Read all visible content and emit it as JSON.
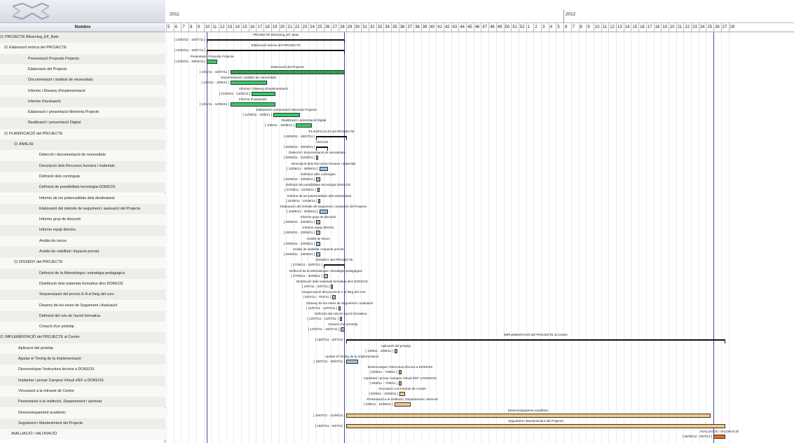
{
  "columns": {
    "name": "Nombre"
  },
  "timeline": {
    "years": [
      "2011",
      "2012"
    ],
    "weeks_2011": [
      "5",
      "6",
      "7",
      "8",
      "9",
      "10",
      "11",
      "12",
      "13",
      "14",
      "15",
      "16",
      "17",
      "18",
      "19",
      "20",
      "21",
      "22",
      "23",
      "24",
      "25",
      "26",
      "27",
      "28",
      "29",
      "30",
      "31",
      "32",
      "33",
      "34",
      "35",
      "36",
      "37",
      "38",
      "39",
      "40",
      "41",
      "42",
      "43",
      "44",
      "45",
      "46",
      "47",
      "48",
      "49",
      "50",
      "51",
      "52"
    ],
    "weeks_2012": [
      "1",
      "2",
      "3",
      "4",
      "5",
      "6",
      "7",
      "8",
      "9",
      "10",
      "11",
      "12",
      "13",
      "14",
      "15",
      "16",
      "17",
      "18",
      "19",
      "20",
      "21",
      "22",
      "23",
      "24",
      "25",
      "26",
      "27",
      "28"
    ]
  },
  "colors": {
    "summary": "#111111",
    "green": "#33cc66",
    "green_hatched": "#2bb35a",
    "blue": "#9fbfe0",
    "orange": "#f0a64a",
    "light_orange": "#f6c987",
    "dark_orange": "#ee6a1a"
  },
  "tasks": [
    {
      "name": "PROJECTE Blearning_EF_Batx",
      "level": 0,
      "toggle": "⊟",
      "dates": "[ 10/03/11 - 16/07/11 ]",
      "type": "summary",
      "start": "2011-03-10",
      "end": "2011-07-16"
    },
    {
      "name": "Elaboració teòrica del PROJECTE",
      "level": 1,
      "toggle": "⊟",
      "dates": "[ 10/03/11 - 16/07/11 ]",
      "type": "summary",
      "start": "2011-03-10",
      "end": "2011-07-16"
    },
    {
      "name": "Presentació Proposta Projecte",
      "level": 2,
      "toggle": "",
      "dates": "[ 10/03/11 - 19/03/11 ]",
      "type": "green",
      "start": "2011-03-10",
      "end": "2011-03-19"
    },
    {
      "name": "Elaboració del Projecte",
      "level": 2,
      "toggle": "",
      "dates": "[ 1/04/11 - 16/07/11 ]",
      "type": "green_hatched",
      "start": "2011-04-01",
      "end": "2011-07-16"
    },
    {
      "name": "Documentació i anàlisis de necessitats",
      "level": 2,
      "toggle": "",
      "dates": "[ 1/04/11 - 4/05/11 ]",
      "type": "green",
      "start": "2011-04-01",
      "end": "2011-05-04"
    },
    {
      "name": "Informe i Disseny d'implementació",
      "level": 2,
      "toggle": "",
      "dates": "[ 21/04/11 - 12/05/11 ]",
      "type": "green",
      "start": "2011-04-21",
      "end": "2011-05-12"
    },
    {
      "name": "Informe d'avaluació",
      "level": 2,
      "toggle": "",
      "dates": "[ 1/04/11 - 12/05/11 ]",
      "type": "green",
      "start": "2011-04-01",
      "end": "2011-05-12"
    },
    {
      "name": "Elaboració i presentació Memòria Projecte",
      "level": 2,
      "toggle": "",
      "dates": "[ 11/05/11 - 4/06/11 ]",
      "type": "green",
      "start": "2011-05-11",
      "end": "2011-06-04"
    },
    {
      "name": "Realització i presentació Digital",
      "level": 2,
      "toggle": "",
      "dates": "[ 1/06/11 - 15/06/11 ]",
      "type": "green",
      "start": "2011-06-01",
      "end": "2011-06-15"
    },
    {
      "name": "PLANIFICACIÓ del PROJECTE",
      "level": 1,
      "toggle": "⊟",
      "dates": "[ 20/06/11 - 18/07/11 ]",
      "type": "summary",
      "start": "2011-06-20",
      "end": "2011-07-18"
    },
    {
      "name": "ANÀLISI",
      "level": 2,
      "toggle": "⊟",
      "dates": "[ 20/06/11 - 30/06/11 ]",
      "type": "summary",
      "start": "2011-06-20",
      "end": "2011-06-30"
    },
    {
      "name": "Detecció i documentació de necessitats",
      "level": 3,
      "toggle": "",
      "dates": "[ 20/06/11 - 21/06/11 ]",
      "type": "blue",
      "start": "2011-06-20",
      "end": "2011-06-21"
    },
    {
      "name": "Descripció dels Recursos humans i materials",
      "level": 3,
      "toggle": "",
      "dates": "[ 23/06/11 - 30/06/11 ]",
      "type": "blue",
      "start": "2011-06-23",
      "end": "2011-06-30"
    },
    {
      "name": "Definició dels continguts",
      "level": 3,
      "toggle": "",
      "dates": "[ 20/06/11 - 23/06/11 ]",
      "type": "blue",
      "start": "2011-06-20",
      "end": "2011-06-23"
    },
    {
      "name": "Definició de possibilitats tecnologia DOKEOS",
      "level": 3,
      "toggle": "",
      "dates": "[ 21/06/11 - 22/06/11 ]",
      "type": "blue",
      "start": "2011-06-21",
      "end": "2011-06-22"
    },
    {
      "name": "Informe de les potencialitats dels destinataris",
      "level": 3,
      "toggle": "",
      "dates": "[ 22/06/11 - 23/06/11 ]",
      "type": "blue",
      "start": "2011-06-22",
      "end": "2011-06-23"
    },
    {
      "name": "Elaboració del mètode de seguiment i avaluació del Projecte",
      "level": 3,
      "toggle": "",
      "dates": "[ 23/06/11 - 30/06/11 ]",
      "type": "blue",
      "start": "2011-06-23",
      "end": "2011-06-30"
    },
    {
      "name": "Informe grup de discusió",
      "level": 3,
      "toggle": "",
      "dates": "[ 20/06/11 - 23/06/11 ]",
      "type": "blue",
      "start": "2011-06-20",
      "end": "2011-06-23"
    },
    {
      "name": "Informe equip directiu",
      "level": 3,
      "toggle": "",
      "dates": "[ 20/06/11 - 23/06/11 ]",
      "type": "blue",
      "start": "2011-06-20",
      "end": "2011-06-23"
    },
    {
      "name": "Anàlisi de riscos",
      "level": 3,
      "toggle": "",
      "dates": "[ 20/06/11 - 23/06/11 ]",
      "type": "blue",
      "start": "2011-06-20",
      "end": "2011-06-23"
    },
    {
      "name": "Anàlisi de viabilitat i Impacte previst",
      "level": 3,
      "toggle": "",
      "dates": "[ 20/06/11 - 23/06/11 ]",
      "type": "blue",
      "start": "2011-06-20",
      "end": "2011-06-23"
    },
    {
      "name": "DISSENY del PROJECTE",
      "level": 2,
      "toggle": "⊟",
      "dates": "[ 27/06/11 - 16/07/11 ]",
      "type": "summary",
      "start": "2011-06-27",
      "end": "2011-07-16"
    },
    {
      "name": "Definició de la Metodologia i estratègia pedagògica",
      "level": 3,
      "toggle": "",
      "dates": "[ 27/06/11 - 30/06/11 ]",
      "type": "blue",
      "start": "2011-06-27",
      "end": "2011-06-30"
    },
    {
      "name": "Distribució dels materials formatius dins DOKEOS",
      "level": 3,
      "toggle": "",
      "dates": "[ 4/07/11 - 5/07/11 ]",
      "type": "blue",
      "start": "2011-07-04",
      "end": "2011-07-05"
    },
    {
      "name": "Sequenciació del procés E-A al llarg del curs",
      "level": 3,
      "toggle": "",
      "dates": "[ 5/07/11 - 7/07/11 ]",
      "type": "blue",
      "start": "2011-07-05",
      "end": "2011-07-07"
    },
    {
      "name": "Disseny de les eines de Seguiment i Avaluació",
      "level": 3,
      "toggle": "",
      "dates": "[ 11/07/11 - 12/07/11 ]",
      "type": "blue",
      "start": "2011-07-11",
      "end": "2011-07-12"
    },
    {
      "name": "Definició del rols de l'acció formativa",
      "level": 3,
      "toggle": "",
      "dates": "[ 12/07/11 - 13/07/11 ]",
      "type": "blue",
      "start": "2011-07-12",
      "end": "2011-07-13"
    },
    {
      "name": "Creació d'un prototip",
      "level": 3,
      "toggle": "",
      "dates": "[ 13/07/11 - 16/07/11 ]",
      "type": "blue",
      "start": "2011-07-13",
      "end": "2011-07-16"
    },
    {
      "name": "IMPLEMENTACIÓ del PROJECTE al Centre",
      "level": 0,
      "toggle": "⊟",
      "dates": "[ 18/07/11 - 5/07/12 ]",
      "type": "summary",
      "start": "2011-07-18",
      "end": "2012-07-05"
    },
    {
      "name": "Aplicació del prototip",
      "level": 1,
      "toggle": "",
      "dates": "[ 1/09/11 - 3/09/11 ]",
      "type": "orange",
      "start": "2011-09-01",
      "end": "2011-09-03"
    },
    {
      "name": "Ajustar el Timing de la Implementació",
      "level": 1,
      "toggle": "",
      "dates": "[ 18/07/11 - 28/07/11 ]",
      "type": "blue",
      "start": "2011-07-18",
      "end": "2011-07-28"
    },
    {
      "name": "Desenvolupar l'estructura tècnica a DOKEOS",
      "level": 1,
      "toggle": "",
      "dates": "[ 5/09/11 - 7/09/11 ]",
      "type": "orange",
      "start": "2011-09-05",
      "end": "2011-09-07"
    },
    {
      "name": "Implantar i provar Campus Virtual d'EF a DOKEOS",
      "level": 1,
      "toggle": "",
      "dates": "[ 5/09/11 - 7/09/11 ]",
      "type": "orange",
      "start": "2011-09-05",
      "end": "2011-09-07"
    },
    {
      "name": "Vinculació a la Intranet de Centre",
      "level": 1,
      "toggle": "",
      "dates": "[ 6/09/11 - 10/09/11 ]",
      "type": "light_orange",
      "start": "2011-09-06",
      "end": "2011-09-10"
    },
    {
      "name": "Presentació a la Institució, Departament i alumnat",
      "level": 1,
      "toggle": "",
      "dates": "[ 1/09/11 - 15/09/11 ]",
      "type": "light_orange",
      "start": "2011-09-01",
      "end": "2011-09-15"
    },
    {
      "name": "Desenvolupament acadèmic",
      "level": 1,
      "toggle": "",
      "dates": "[ 18/07/11 - 21/06/12 ]",
      "type": "light_orange",
      "start": "2011-07-18",
      "end": "2012-06-21"
    },
    {
      "name": "Seguiment i Mantenimient del Projecte",
      "level": 1,
      "toggle": "",
      "dates": "[ 18/07/11 - 5/07/12 ]",
      "type": "light_orange",
      "start": "2011-07-18",
      "end": "2012-07-05"
    },
    {
      "name": "AVALUACIÓ i VALORACIÓ",
      "level": 0,
      "toggle": "",
      "dates": "[ 25/06/12 - 5/07/12 ]",
      "type": "dark_orange",
      "start": "2012-06-25",
      "end": "2012-07-05"
    }
  ]
}
